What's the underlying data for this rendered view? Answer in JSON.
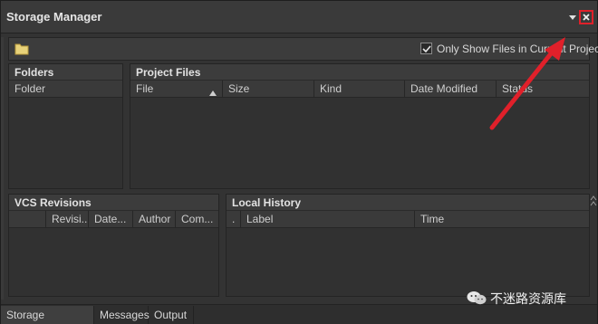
{
  "window": {
    "title": "Storage Manager",
    "colors": {
      "background": "#333333",
      "titlebar": "#3a3a3a",
      "annotation": "#e0202a",
      "folder": "#e8d27a"
    }
  },
  "toolbar": {
    "folder_icon": "folder-icon",
    "only_show_files_label": "Only Show Files in Current Project",
    "only_show_files_checked": true
  },
  "folders_panel": {
    "title": "Folders",
    "columns": [
      "Folder"
    ]
  },
  "project_files_panel": {
    "title": "Project Files",
    "columns": [
      "File",
      "Size",
      "Kind",
      "Date Modified",
      "Status"
    ]
  },
  "vcs_panel": {
    "title": "VCS Revisions",
    "columns": [
      "",
      "Revisi...",
      "Date...",
      "Author",
      "Com..."
    ]
  },
  "local_history_panel": {
    "title": "Local History",
    "columns": [
      ".",
      "Label",
      "Time"
    ]
  },
  "tabs": [
    "Storage Manager",
    "Messages",
    "Output"
  ],
  "active_tab": 0,
  "watermark": {
    "text": "不迷路资源库"
  }
}
